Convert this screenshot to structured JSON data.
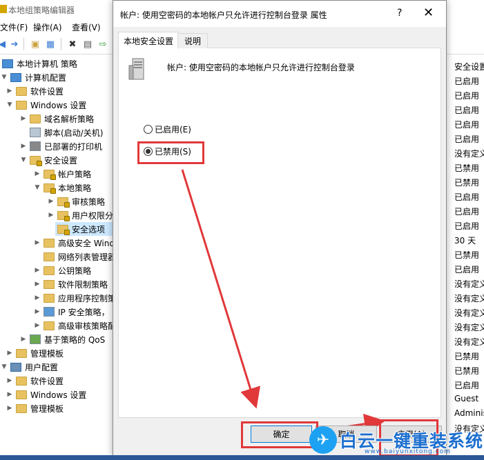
{
  "main_window": {
    "title": "本地组策略编辑器",
    "menu": [
      "文件(F)",
      "操作(A)",
      "查看(V)"
    ],
    "toolbar_icons": [
      "back-arrow-icon",
      "forward-arrow-icon",
      "up-folder-icon",
      "show-tree-icon",
      "delete-icon",
      "properties-icon",
      "export-icon"
    ]
  },
  "tree": [
    {
      "label": "本地计算机 策略",
      "icon": "pc-icon"
    },
    {
      "label": "计算机配置",
      "icon": "pc-icon"
    },
    {
      "label": "软件设置",
      "icon": "folder-icon"
    },
    {
      "label": "Windows 设置",
      "icon": "folder-icon"
    },
    {
      "label": "域名解析策略",
      "icon": "folder-icon"
    },
    {
      "label": "脚本(启动/关机)",
      "icon": "script-icon"
    },
    {
      "label": "已部署的打印机",
      "icon": "printer-icon"
    },
    {
      "label": "安全设置",
      "icon": "security-icon"
    },
    {
      "label": "帐户策略",
      "icon": "folder-icon"
    },
    {
      "label": "本地策略",
      "icon": "folder-icon"
    },
    {
      "label": "审核策略",
      "icon": "folder-icon"
    },
    {
      "label": "用户权限分",
      "icon": "folder-icon"
    },
    {
      "label": "安全选项",
      "icon": "folder-icon"
    },
    {
      "label": "高级安全 Wind",
      "icon": "folder-icon"
    },
    {
      "label": "网络列表管理器",
      "icon": "folder-icon"
    },
    {
      "label": "公钥策略",
      "icon": "folder-icon"
    },
    {
      "label": "软件限制策略",
      "icon": "folder-icon"
    },
    {
      "label": "应用程序控制策",
      "icon": "folder-icon"
    },
    {
      "label": "IP 安全策略，",
      "icon": "ipsec-icon"
    },
    {
      "label": "高级审核策略配",
      "icon": "folder-icon"
    },
    {
      "label": "基于策略的 QoS",
      "icon": "chart-icon"
    },
    {
      "label": "管理模板",
      "icon": "folder-icon"
    },
    {
      "label": "用户配置",
      "icon": "user-icon"
    },
    {
      "label": "软件设置",
      "icon": "folder-icon"
    },
    {
      "label": "Windows 设置",
      "icon": "folder-icon"
    },
    {
      "label": "管理模板",
      "icon": "folder-icon"
    }
  ],
  "right_column": {
    "header": "安全设置",
    "values": [
      "已启用",
      "已启用",
      "已启用",
      "已启用",
      "已启用",
      "没有定义",
      "已禁用",
      "已禁用",
      "已启用",
      "已启用",
      "已启用",
      "30 天",
      "已禁用",
      "已启用",
      "没有定义",
      "没有定义",
      "没有定义",
      "没有定义",
      "没有定义",
      "已禁用",
      "已禁用",
      "已启用",
      "Guest",
      "Adminis",
      "没有定义"
    ]
  },
  "dialog": {
    "title": "帐户: 使用空密码的本地帐户只允许进行控制台登录 属性",
    "help": "?",
    "close": "✕",
    "tabs": [
      "本地安全设置",
      "说明"
    ],
    "policy_name": "帐户: 使用空密码的本地帐户只允许进行控制台登录",
    "options": {
      "enabled": "已启用(E)",
      "disabled": "已禁用(S)"
    },
    "selected": "disabled",
    "buttons": {
      "ok": "确定",
      "cancel": "取消",
      "apply": "应用(A)"
    }
  },
  "watermark": {
    "text": "白云一键重装系统",
    "url": "www.baiyunxitong.com"
  },
  "colors": {
    "highlight": "#e1383a",
    "selection": "#cde8ff",
    "folder": "#e8c260"
  }
}
